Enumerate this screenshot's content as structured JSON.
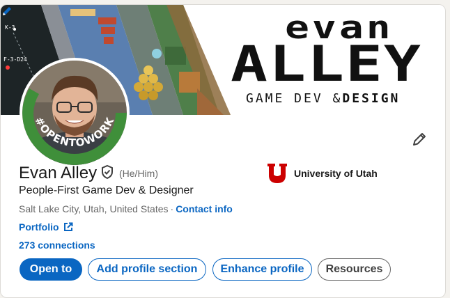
{
  "banner": {
    "logo_line1": "evan",
    "logo_line2": "ALLEY",
    "tagline_prefix": "GAME DEV &",
    "tagline_suffix": "DESIGN",
    "star_label_1": "K-3",
    "star_label_2": "F-3-D24"
  },
  "avatar": {
    "badge_text": "#OPENTOWORK"
  },
  "profile": {
    "name": "Evan Alley",
    "pronouns": "(He/Him)",
    "headline": "People-First Game Dev & Designer",
    "location": "Salt Lake City, Utah, United States",
    "separator": "·",
    "contact_label": "Contact info",
    "portfolio_label": "Portfolio",
    "connections": "273 connections"
  },
  "education": {
    "school": "University of Utah",
    "logo_letter": "U"
  },
  "actions": {
    "open_to": "Open to",
    "add_section": "Add profile section",
    "enhance": "Enhance profile",
    "resources": "Resources"
  },
  "colors": {
    "accent": "#0a66c2",
    "badge_green": "#3f8f3a",
    "utah_red": "#cc0000"
  }
}
